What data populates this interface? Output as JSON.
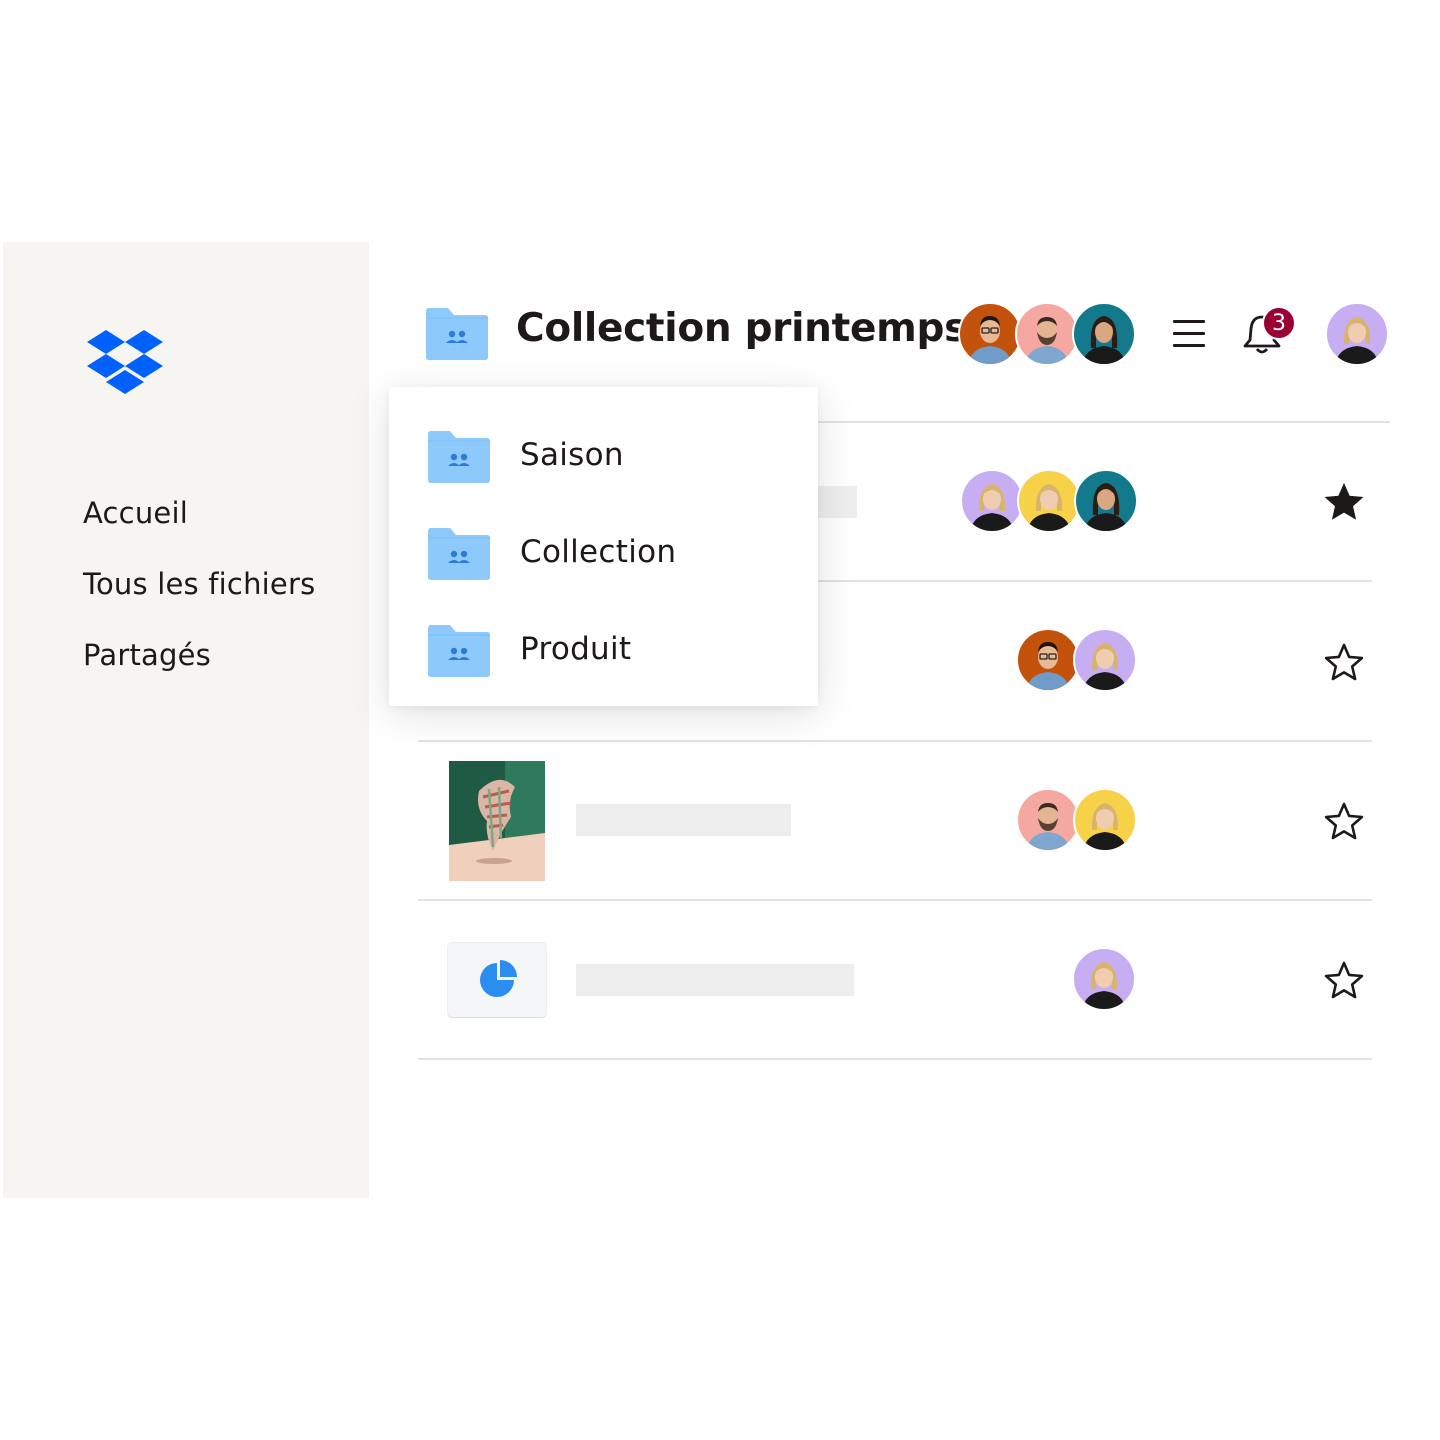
{
  "sidebar": {
    "logo": "dropbox-logo",
    "items": [
      {
        "label": "Accueil"
      },
      {
        "label": "Tous les fichiers"
      },
      {
        "label": "Partagés"
      }
    ]
  },
  "header": {
    "title": "Collection printemps",
    "notifications_count": "3"
  },
  "dropdown": {
    "items": [
      {
        "label": "Saison"
      },
      {
        "label": "Collection"
      },
      {
        "label": "Produit"
      }
    ]
  },
  "rows": [
    {
      "type": "folder",
      "starred": true
    },
    {
      "type": "folder",
      "starred": false
    },
    {
      "type": "image",
      "starred": false
    },
    {
      "type": "chart-file",
      "starred": false
    }
  ],
  "colors": {
    "brand": "#0061fe",
    "folder": "#8ec9fb",
    "badge": "#9b0032",
    "sidebar_bg": "#f6f5f2",
    "avatar_orange": "#c3520c",
    "avatar_pink": "#f5a8a0",
    "avatar_teal": "#127a8c",
    "avatar_purple": "#c7aef2",
    "avatar_yellow": "#f7d148"
  }
}
